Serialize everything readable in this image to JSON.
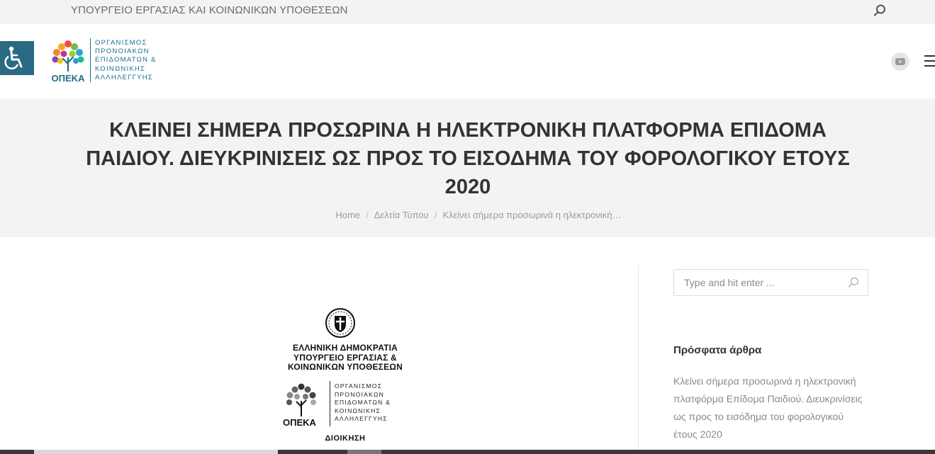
{
  "topbar": {
    "ministry": "ΥΠΟΥΡΓΕΙΟ ΕΡΓΑΣΙΑΣ ΚΑΙ ΚΟΙΝΩΝΙΚΩΝ ΥΠΟΘΕΣΕΩΝ",
    "search_icon": "search-icon"
  },
  "header": {
    "logo_acronym": "ΟΠΕΚΑ",
    "logo_lines": [
      "ΟΡΓΑΝΙΣΜΟΣ",
      "ΠΡΟΝΟΙΑΚΩΝ",
      "ΕΠΙΔΟΜΑΤΩΝ &",
      "ΚΟΙΝΩΝΙΚΗΣ",
      "ΑΛΛΗΛΕΓΓΥΗΣ"
    ],
    "accessibility_icon": "wheelchair-icon",
    "youtube_icon": "youtube-icon",
    "menu_icon": "hamburger-icon",
    "accent_color": "#2a6a82"
  },
  "page": {
    "title": "ΚΛΕΙΝΕΙ ΣΗΜΕΡΑ ΠΡΟΣΩΡΙΝΑ Η ΗΛΕΚΤΡΟΝΙΚΗ ΠΛΑΤΦΟΡΜΑ ΕΠΙΔΟΜΑ ΠΑΙΔΙΟΥ. ΔΙΕΥΚΡΙΝΙΣΕΙΣ ΩΣ ΠΡΟΣ ΤΟ ΕΙΣΟΔΗΜΑ ΤΟΥ ΦΟΡΟΛΟΓΙΚΟΥ ΕΤΟΥΣ 2020",
    "breadcrumbs": [
      "Home",
      "Δελτία Τύπου",
      "Κλείνει σήμερα προσωρινά η ηλεκτρονική…"
    ]
  },
  "press_image": {
    "heading_lines": [
      "ΕΛΛΗΝΙΚΗ ΔΗΜΟΚΡΑΤΙΑ",
      "ΥΠΟΥΡΓΕΙΟ ΕΡΓΑΣΙΑΣ &",
      "ΚΟΙΝΩΝΙΚΩΝ ΥΠΟΘΕΣΕΩΝ"
    ],
    "org_lines": [
      "ΟΡΓΑΝΙΣΜΟΣ",
      "ΠΡΟΝΟΙΑΚΩΝ",
      "ΕΠΙΔΟΜΑΤΩΝ &",
      "ΚΟΙΝΩΝΙΚΗΣ",
      "ΑΛΛΗΛΕΓΓΥΗΣ"
    ],
    "acronym": "ΟΠΕΚΑ",
    "footer": "ΔΙΟΙΚΗΣΗ"
  },
  "sidebar": {
    "search_placeholder": "Type and hit enter ...",
    "recent_heading": "Πρόσφατα άρθρα",
    "recent_posts": [
      "Κλείνει σήμερα προσωρινά η ηλεκτρονική πλατφόρμα Επίδομα Παιδιού. Διευκρινίσεις ως προς το εισόδημα του φορολογικού έτους 2020"
    ]
  }
}
